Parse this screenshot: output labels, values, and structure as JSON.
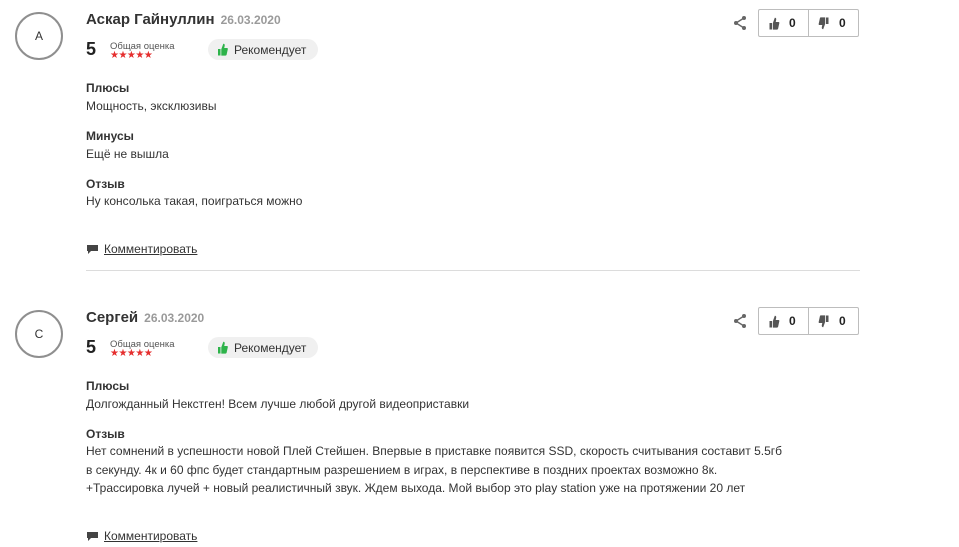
{
  "reviews": [
    {
      "avatar_letter": "А",
      "author": "Аскар Гайнуллин",
      "date": "26.03.2020",
      "score": "5",
      "score_label": "Общая оценка",
      "stars": "★★★★★",
      "recommend_label": "Рекомендует",
      "likes": "0",
      "dislikes": "0",
      "pros_title": "Плюсы",
      "pros": "Мощность, эксклюзивы",
      "cons_title": "Минусы",
      "cons": "Ещё не вышла",
      "review_title": "Отзыв",
      "review_lines": [
        "Ну консолька такая, поиграться можно"
      ],
      "comment_label": "Комментировать"
    },
    {
      "avatar_letter": "С",
      "author": "Сергей",
      "date": "26.03.2020",
      "score": "5",
      "score_label": "Общая оценка",
      "stars": "★★★★★",
      "recommend_label": "Рекомендует",
      "likes": "0",
      "dislikes": "0",
      "pros_title": "Плюсы",
      "pros": "Долгожданный Некстген! Всем лучше любой другой видеоприставки",
      "review_title": "Отзыв",
      "review_lines": [
        "Нет сомнений в успешности новой Плей Стейшен. Впервые в приставке появится SSD, скорость считывания составит 5.5гб",
        "в секунду. 4к и 60 фпс будет стандартным разрешением в играх, в перспективе в поздних проектах возможно 8к.",
        "+Трассировка лучей + новый реалистичный звук. Ждем выхода. Мой выбор это play station уже на протяжении 20 лет"
      ],
      "comment_label": "Комментировать"
    }
  ],
  "colors": {
    "stars": "#e52e2e",
    "recommend_icon": "#2db34a",
    "vote_icon": "#555555"
  },
  "icons": {
    "share": "share-icon",
    "like": "thumbs-up-icon",
    "dislike": "thumbs-down-icon",
    "comment": "comment-icon",
    "recommend": "thumbs-up-icon"
  }
}
